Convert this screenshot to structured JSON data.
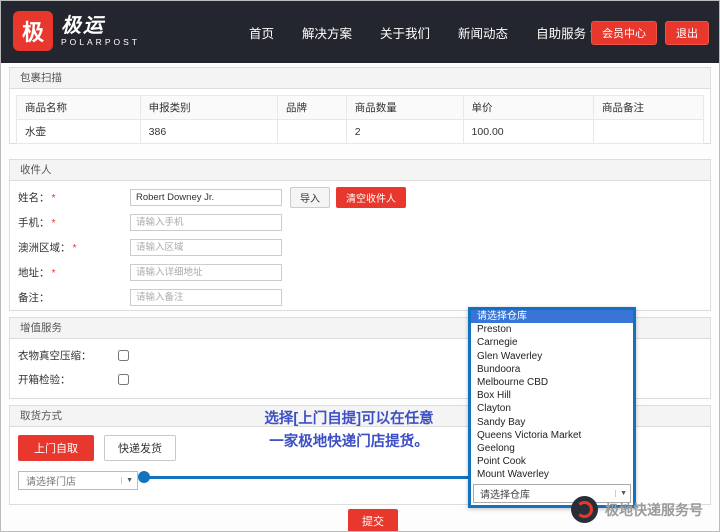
{
  "header": {
    "brand": {
      "icon_char": "极",
      "name_cn": "极运",
      "name_en": "POLARPOST"
    },
    "nav": [
      {
        "label": "首页"
      },
      {
        "label": "解决方案"
      },
      {
        "label": "关于我们"
      },
      {
        "label": "新闻动态"
      },
      {
        "label": "自助服务"
      }
    ],
    "member_center_button": "会员中心",
    "logout_button": "退出"
  },
  "icons": {
    "chevron_down": "▾",
    "caret_down": "▼"
  },
  "package_panel": {
    "title": "包裹扫描",
    "headers": [
      "商品名称",
      "申报类别",
      "品牌",
      "商品数量",
      "单价",
      "商品备注"
    ],
    "row": [
      "水壶",
      "386",
      "",
      "2",
      "100.00",
      ""
    ]
  },
  "recipient_panel": {
    "title": "收件人",
    "required_mark": "*",
    "fields": [
      {
        "label": "姓名：",
        "value": "Robert Downey Jr.",
        "placeholder": ""
      },
      {
        "label": "手机：",
        "placeholder": "请输入手机"
      },
      {
        "label": "澳洲区域：",
        "placeholder": "请输入区域"
      },
      {
        "label": "地址：",
        "placeholder": "请输入详细地址"
      },
      {
        "label": "备注：",
        "placeholder": "请输入备注"
      }
    ],
    "import_button": "导入",
    "clear_button": "清空收件人"
  },
  "services_panel": {
    "title": "增值服务",
    "options": [
      {
        "label": "衣物真空压缩："
      },
      {
        "label": "开箱检验："
      }
    ]
  },
  "pickup_panel": {
    "title": "取货方式",
    "self_pickup_button": "上门自取",
    "courier_button": "快递发货",
    "store_select_placeholder": "请选择门店",
    "annotation_line1": "选择[上门自提]可以在任意",
    "annotation_line2": "一家极地快递门店提货。"
  },
  "warehouse_dropdown": {
    "placeholder_option": "请选择仓库",
    "options": [
      "Preston",
      "Carnegie",
      "Glen Waverley",
      "Bundoora",
      "Melbourne CBD",
      "Box Hill",
      "Clayton",
      "Sandy Bay",
      "Queens Victoria Market",
      "Geelong",
      "Point Cook",
      "Mount Waverley"
    ],
    "select_value": "请选择仓库"
  },
  "submit_button": "提交",
  "watermark_text": "极地快递服务号",
  "colors": {
    "accent_red": "#e8382d",
    "header_bg": "#23262e",
    "highlight_blue": "#1273bc",
    "selected_blue": "#3875d7",
    "annotation_blue": "#3d4fc4"
  }
}
